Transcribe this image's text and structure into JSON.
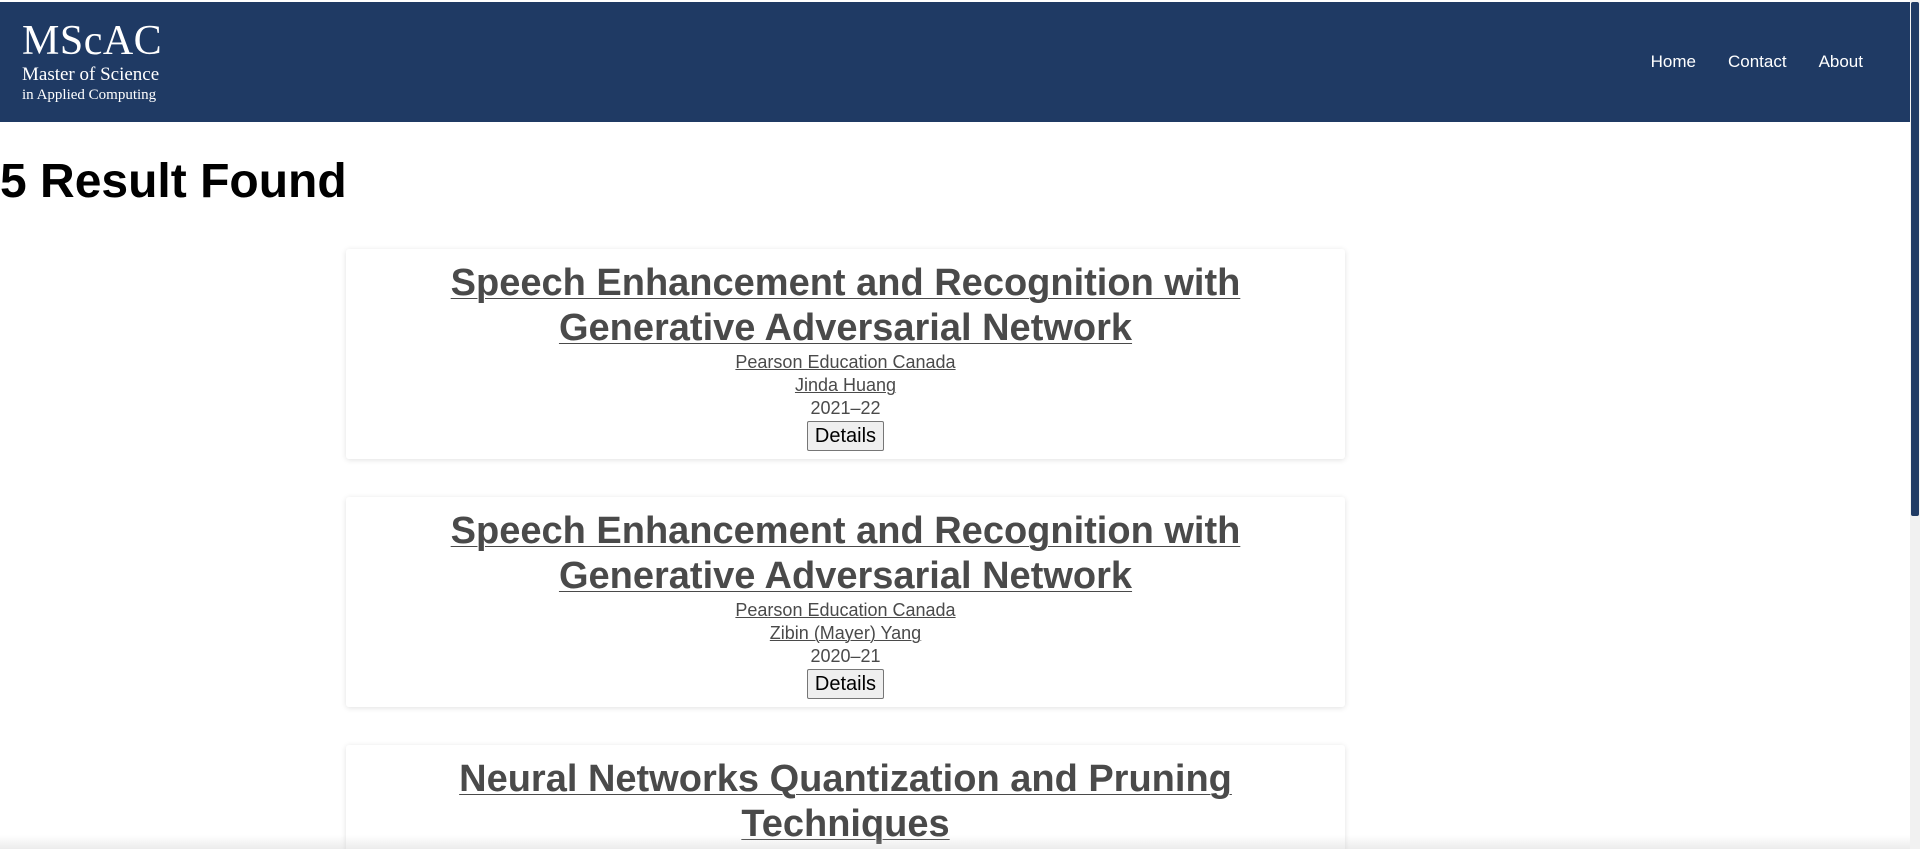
{
  "header": {
    "logo": {
      "main": "MScAC",
      "line1": "Master of Science",
      "line2": "in Applied Computing"
    },
    "nav": [
      {
        "label": "Home"
      },
      {
        "label": "Contact"
      },
      {
        "label": "About"
      }
    ]
  },
  "main": {
    "results_heading": "5 Result Found",
    "cards": [
      {
        "title": "Speech Enhancement and Recognition with Generative Adversarial Network",
        "organization": "Pearson Education Canada",
        "student": "Jinda Huang",
        "year": "2021–22",
        "button": "Details"
      },
      {
        "title": "Speech Enhancement and Recognition with Generative Adversarial Network",
        "organization": "Pearson Education Canada",
        "student": "Zibin (Mayer) Yang",
        "year": "2020–21",
        "button": "Details"
      },
      {
        "title": "Neural Networks Quantization and Pruning Techniques"
      }
    ]
  },
  "colors": {
    "header_bg": "#1f3a64",
    "card_text": "#4a4a4a"
  }
}
